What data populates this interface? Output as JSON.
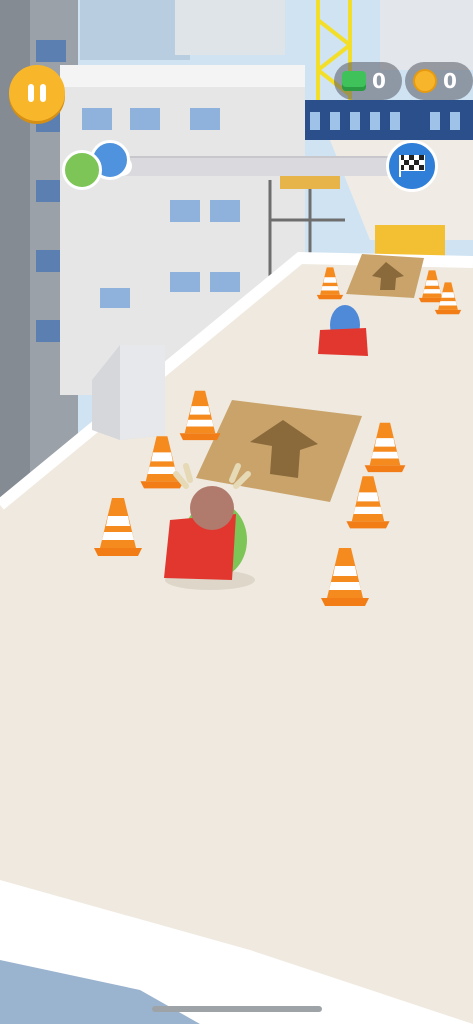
{
  "hud": {
    "gems": "0",
    "coins": "0",
    "race_progress": 0.12
  },
  "colors": {
    "sky": "#cfe3f2",
    "rooftop": "#efe9df",
    "cone": "#f58a1f",
    "cape": "#e2372f",
    "pause": "#f8b62a"
  },
  "icons": [
    "pause-icon",
    "gem-icon",
    "coin-icon",
    "checkered-flag-icon",
    "arrow-up-icon"
  ]
}
